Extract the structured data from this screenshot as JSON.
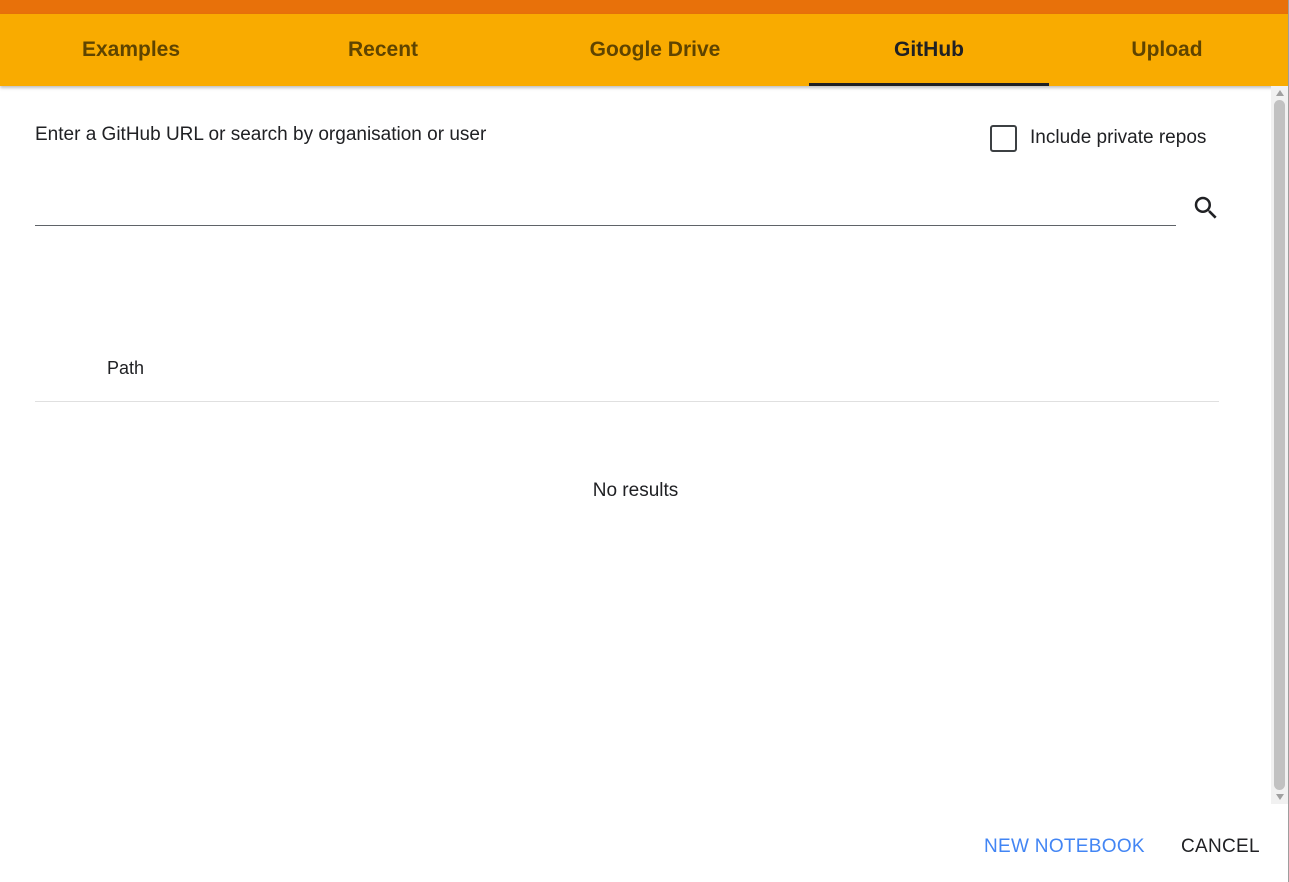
{
  "tabs": [
    {
      "label": "Examples",
      "active": false
    },
    {
      "label": "Recent",
      "active": false
    },
    {
      "label": "Google Drive",
      "active": false
    },
    {
      "label": "GitHub",
      "active": true
    },
    {
      "label": "Upload",
      "active": false
    }
  ],
  "colors": {
    "tab_bar": "#f9ab00",
    "top_strip": "#e8710a",
    "primary_button": "#4285f4",
    "text": "#202124"
  },
  "search": {
    "label": "Enter a GitHub URL or search by organisation or user",
    "value": "",
    "placeholder": "",
    "icon": "search-icon"
  },
  "private_repos": {
    "label": "Include private repos",
    "checked": false
  },
  "table": {
    "columns": [
      "Path"
    ],
    "empty_message": "No results"
  },
  "actions": {
    "new_notebook": "NEW NOTEBOOK",
    "cancel": "CANCEL"
  }
}
